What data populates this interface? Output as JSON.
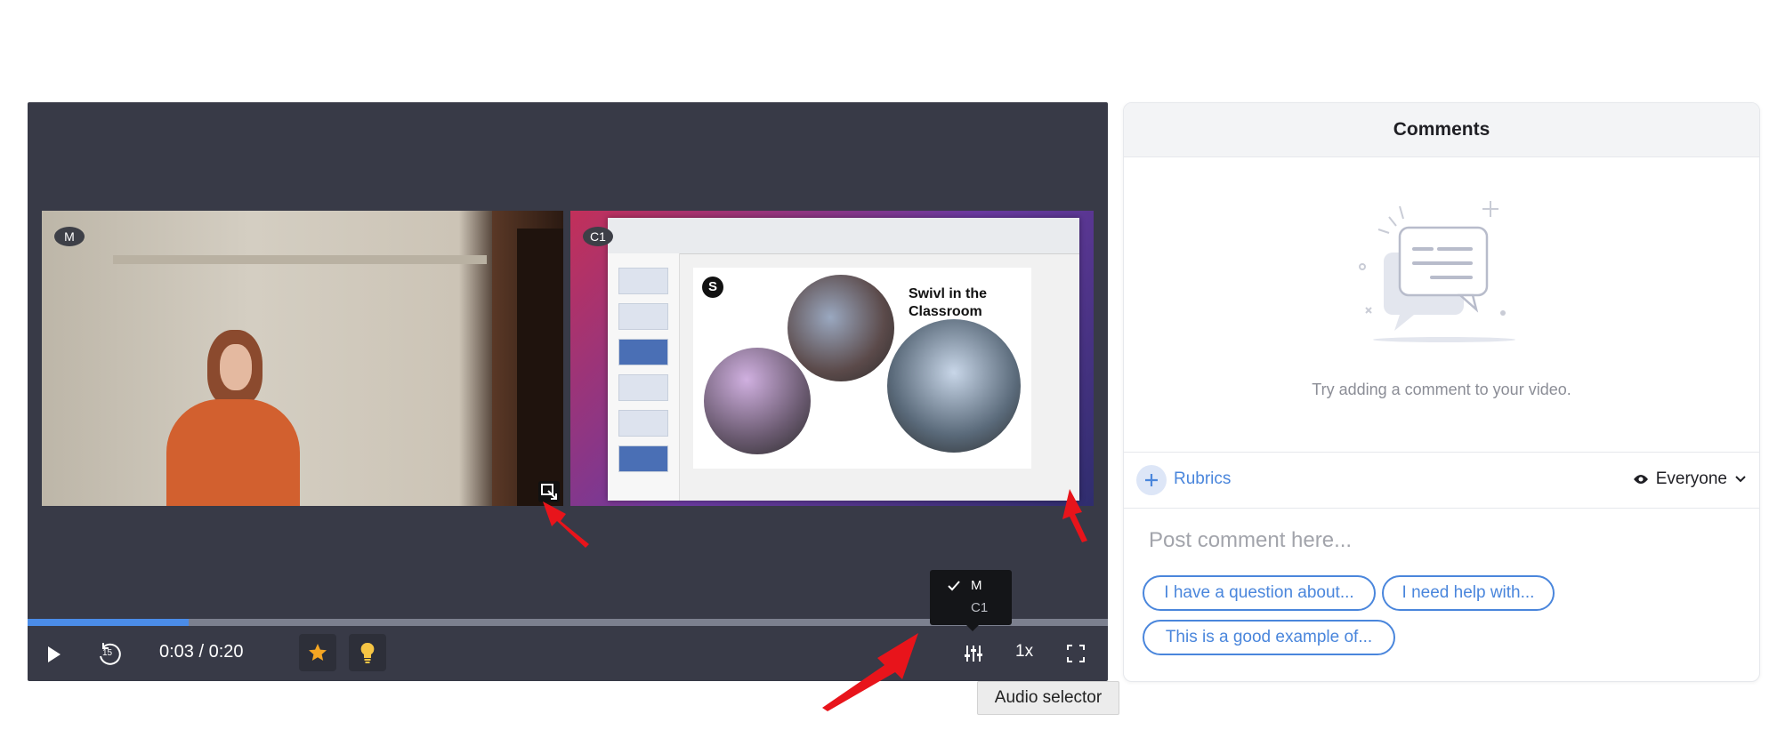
{
  "player": {
    "streams": [
      {
        "badge": "M"
      },
      {
        "badge": "C1"
      }
    ],
    "slide": {
      "title": "Swivl in the Classroom",
      "logo": "S"
    },
    "progress_fraction": 0.149,
    "time": {
      "current": "0:03",
      "total": "0:20",
      "separator": " / "
    },
    "speed_label": "1x",
    "rewind_label": "15",
    "audio_menu": {
      "options": [
        "M",
        "C1"
      ],
      "selected": "M"
    },
    "tooltip": "Audio selector",
    "icons": {
      "play": "play-icon",
      "rewind": "rewind-15-icon",
      "star": "star-icon",
      "idea": "lightbulb-icon",
      "mixer": "audio-mixer-icon",
      "fullscreen": "fullscreen-icon",
      "swap": "swap-stream-icon",
      "check": "check-icon"
    },
    "colors": {
      "accent": "#4b8ce8",
      "star": "#f5a623",
      "bulb": "#f6c544",
      "annotation": "#e8141b"
    }
  },
  "comments": {
    "title": "Comments",
    "empty_message": "Try adding a comment to your video.",
    "rubrics_label": "Rubrics",
    "visibility_label": "Everyone",
    "input_placeholder": "Post comment here...",
    "input_value": "",
    "suggestions": [
      "I have a question about...",
      "I need help with...",
      "This is a good example of..."
    ],
    "colors": {
      "link": "#4a86dc"
    }
  }
}
